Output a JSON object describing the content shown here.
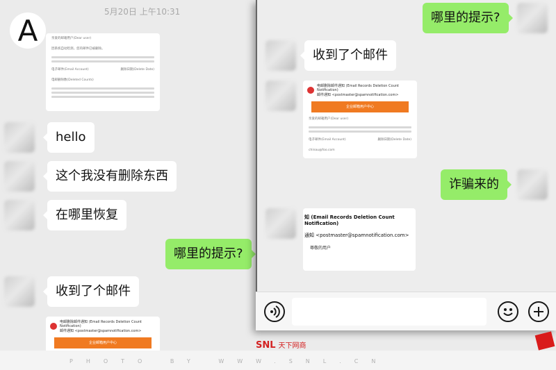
{
  "back_chat": {
    "timestamp": "5月20日 上午10:31",
    "badge_letter": "A",
    "email_preview": {
      "intro": "亲爱的邮箱用户(Dear user)",
      "body": "因系统自动检测，您的邮件已被删除。",
      "field_account": "电子邮件(Email Account)",
      "field_date": "删除日期(Delete Date)",
      "field_count": "电邮删除数(Deleted Counts)"
    },
    "messages": [
      "hello",
      "这个我没有删除东西",
      "在哪里恢复",
      "哪里的提示?",
      "收到了个邮件"
    ],
    "bottom_email": {
      "subject": "电邮删除邮件通知 (Email Records Deletion Count Notification)",
      "sender": "邮件通知 <postmaster@spamnotification.com>",
      "banner": "企业邮箱用户中心"
    }
  },
  "front_chat": {
    "messages": [
      "哪里的提示?",
      "收到了个邮件",
      "诈骗来的"
    ],
    "email_card": {
      "subject": "电邮删除邮件通知 (Email Records Deletion Count Notification)",
      "sender": "邮件通知 <postmaster@spamnotification.com>",
      "banner": "企业邮箱用户中心",
      "intro": "亲爱的邮箱用户(Dear user)",
      "field_account": "电子邮件(Email Account)",
      "field_date": "删除日期(Delete Date)",
      "email_value": "chinau@foo.com"
    },
    "zoom_card": {
      "title": "知 (Email Records Deletion Count Notification)",
      "sender": "通知 <postmaster@spamnotification.com>",
      "recipient": "尊敬的用户"
    },
    "bottom_bar": {
      "voice_icon": "voice-icon",
      "emoji_icon": "emoji-icon",
      "plus_icon": "plus-icon"
    }
  },
  "watermark": {
    "logo": "SNL",
    "logo_sub": "天下网商",
    "text": "PHOTO BY WWW.SNL.CN"
  },
  "colors": {
    "bubble_green": "#95ec69",
    "bubble_white": "#ffffff",
    "chat_bg": "#ededed",
    "mail_banner": "#f07a21",
    "watermark_red": "#d32020"
  }
}
